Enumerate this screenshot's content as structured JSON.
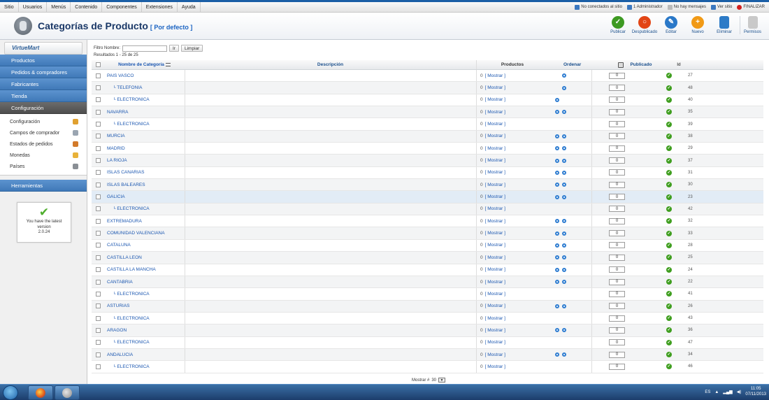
{
  "menubar": {
    "items": [
      "Sitio",
      "Usuarios",
      "Menús",
      "Contenido",
      "Componentes",
      "Extensiones",
      "Ayuda"
    ],
    "status": {
      "offline": "No conectados al sitio",
      "admin": "1 Administrador",
      "messages": "No hay mensajes",
      "view_site": "Ver sitio",
      "logout": "FINALIZAR"
    }
  },
  "header": {
    "title": "Categorías de Producto",
    "subtitle": "[ Por defecto ]"
  },
  "toolbar": {
    "publish": "Publicar",
    "unpublish": "Despublicado",
    "edit": "Editar",
    "new": "Nuevo",
    "delete": "Eliminar",
    "permissions": "Permisos"
  },
  "sidebar": {
    "logo": "VirtueMart",
    "items": [
      "Productos",
      "Pedidos & compradores",
      "Fabricantes",
      "Tienda",
      "Configuración"
    ],
    "subitems": [
      "Configuración",
      "Campos de comprador",
      "Estados de pedidos",
      "Monedas",
      "Países"
    ],
    "tools": "Herramientas",
    "version_line1": "You have the latest",
    "version_line2": "version",
    "version_number": "2.0.24"
  },
  "filter": {
    "label": "Filtro Nombre:",
    "go": "Ir",
    "reset": "Limpiar",
    "results": "Resultados 1 - 25 de 25"
  },
  "table": {
    "headers": {
      "name": "Nombre de Categoría",
      "description": "Descripción",
      "products": "Productos",
      "order": "Ordenar",
      "published": "Publicado",
      "id": "Id"
    },
    "show_link": "[ Mostrar ]",
    "rows": [
      {
        "name": "PAIS VASCO",
        "child": false,
        "count": "0",
        "up": false,
        "down": true,
        "order": "0",
        "id": "27"
      },
      {
        "name": "└ TELEFONIA",
        "child": true,
        "count": "0",
        "up": false,
        "down": true,
        "order": "0",
        "id": "48"
      },
      {
        "name": "└ ELECTRONICA",
        "child": true,
        "count": "0",
        "up": true,
        "down": false,
        "order": "0",
        "id": "40"
      },
      {
        "name": "NAVARRA",
        "child": false,
        "count": "0",
        "up": true,
        "down": true,
        "order": "0",
        "id": "35"
      },
      {
        "name": "└ ELECTRONICA",
        "child": true,
        "count": "0",
        "up": false,
        "down": false,
        "order": "0",
        "id": "39"
      },
      {
        "name": "MURCIA",
        "child": false,
        "count": "0",
        "up": true,
        "down": true,
        "order": "0",
        "id": "38"
      },
      {
        "name": "MADRID",
        "child": false,
        "count": "0",
        "up": true,
        "down": true,
        "order": "0",
        "id": "29"
      },
      {
        "name": "LA RIOJA",
        "child": false,
        "count": "0",
        "up": true,
        "down": true,
        "order": "0",
        "id": "37"
      },
      {
        "name": "ISLAS CANARIAS",
        "child": false,
        "count": "0",
        "up": true,
        "down": true,
        "order": "0",
        "id": "31"
      },
      {
        "name": "ISLAS BALEARES",
        "child": false,
        "count": "0",
        "up": true,
        "down": true,
        "order": "0",
        "id": "30"
      },
      {
        "name": "GALICIA",
        "child": false,
        "count": "0",
        "up": true,
        "down": true,
        "order": "0",
        "id": "23"
      },
      {
        "name": "└ ELECTRONICA",
        "child": true,
        "count": "0",
        "up": false,
        "down": false,
        "order": "0",
        "id": "42"
      },
      {
        "name": "EXTREMADURA",
        "child": false,
        "count": "0",
        "up": true,
        "down": true,
        "order": "0",
        "id": "32"
      },
      {
        "name": "COMUNIDAD VALENCIANA",
        "child": false,
        "count": "0",
        "up": true,
        "down": true,
        "order": "0",
        "id": "33"
      },
      {
        "name": "CATALUÑA",
        "child": false,
        "count": "0",
        "up": true,
        "down": true,
        "order": "0",
        "id": "28"
      },
      {
        "name": "CASTILLA LEON",
        "child": false,
        "count": "0",
        "up": true,
        "down": true,
        "order": "0",
        "id": "25"
      },
      {
        "name": "CASTILLA LA MANCHA",
        "child": false,
        "count": "0",
        "up": true,
        "down": true,
        "order": "0",
        "id": "24"
      },
      {
        "name": "CANTABRIA",
        "child": false,
        "count": "0",
        "up": true,
        "down": true,
        "order": "0",
        "id": "22"
      },
      {
        "name": "└ ELECTRONICA",
        "child": true,
        "count": "0",
        "up": false,
        "down": false,
        "order": "0",
        "id": "41"
      },
      {
        "name": "ASTURIAS",
        "child": false,
        "count": "0",
        "up": true,
        "down": true,
        "order": "0",
        "id": "26"
      },
      {
        "name": "└ ELECTRONICA",
        "child": true,
        "count": "0",
        "up": false,
        "down": false,
        "order": "0",
        "id": "43"
      },
      {
        "name": "ARAGON",
        "child": false,
        "count": "0",
        "up": true,
        "down": true,
        "order": "0",
        "id": "36"
      },
      {
        "name": "└ ELECTRONICA",
        "child": true,
        "count": "0",
        "up": false,
        "down": false,
        "order": "0",
        "id": "47"
      },
      {
        "name": "ANDALUCIA",
        "child": false,
        "count": "0",
        "up": true,
        "down": true,
        "order": "0",
        "id": "34"
      },
      {
        "name": "└ ELECTRONICA",
        "child": true,
        "count": "0",
        "up": false,
        "down": false,
        "order": "0",
        "id": "46"
      }
    ],
    "pager": "Mostrar #",
    "pager_value": "30"
  },
  "taskbar": {
    "lang": "ES",
    "time": "11:05",
    "date": "07/11/2013"
  },
  "colors": {
    "accent": "#1a63c2",
    "sidebar_blue": "#4a85c4",
    "published_green": "#3f9e1f"
  }
}
